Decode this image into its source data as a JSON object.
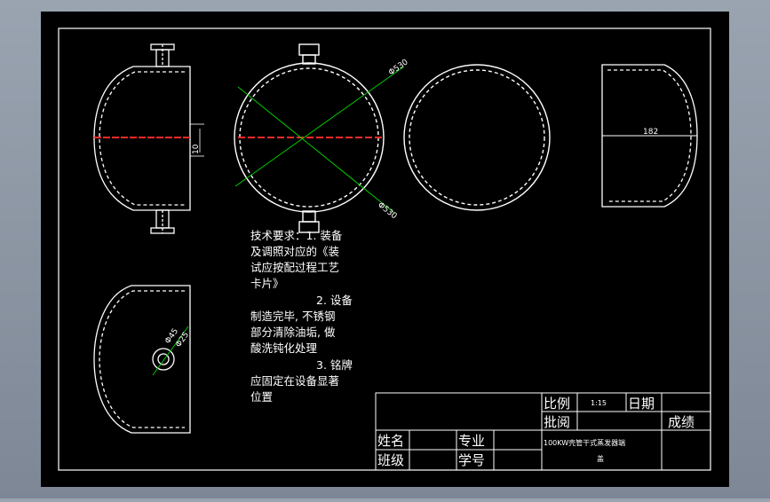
{
  "drawing": {
    "dimensions": {
      "dia_top": "Φ530",
      "dia_bottom": "Φ530",
      "left_height": "10",
      "right_width": "182",
      "nozzle_outer": "Φ45",
      "nozzle_inner": "Φ25"
    },
    "notes": [
      "技术要求：1. 装备",
      "及调照对应的《装",
      "试应按配过程工艺",
      "卡片》",
      "2. 设备",
      "制造完毕, 不锈钢",
      "部分清除油垢, 做",
      "酸洗钝化处理",
      "3. 铭牌",
      "应固定在设备显著",
      "位置"
    ],
    "title_block": {
      "scale_label": "比例",
      "scale_value": "1:15",
      "date_label": "日期",
      "review_label": "批阅",
      "grade_label": "成绩",
      "name_label": "姓名",
      "major_label": "专业",
      "class_label": "班级",
      "student_no_label": "学号",
      "drawing_title_1": "100KW壳管干式蒸发器端",
      "drawing_title_2": "盖"
    }
  },
  "colors": {
    "background": "#000000",
    "frame": "#ffffff",
    "center_line": "#ff2a2a",
    "dimension": "#00cc00"
  }
}
